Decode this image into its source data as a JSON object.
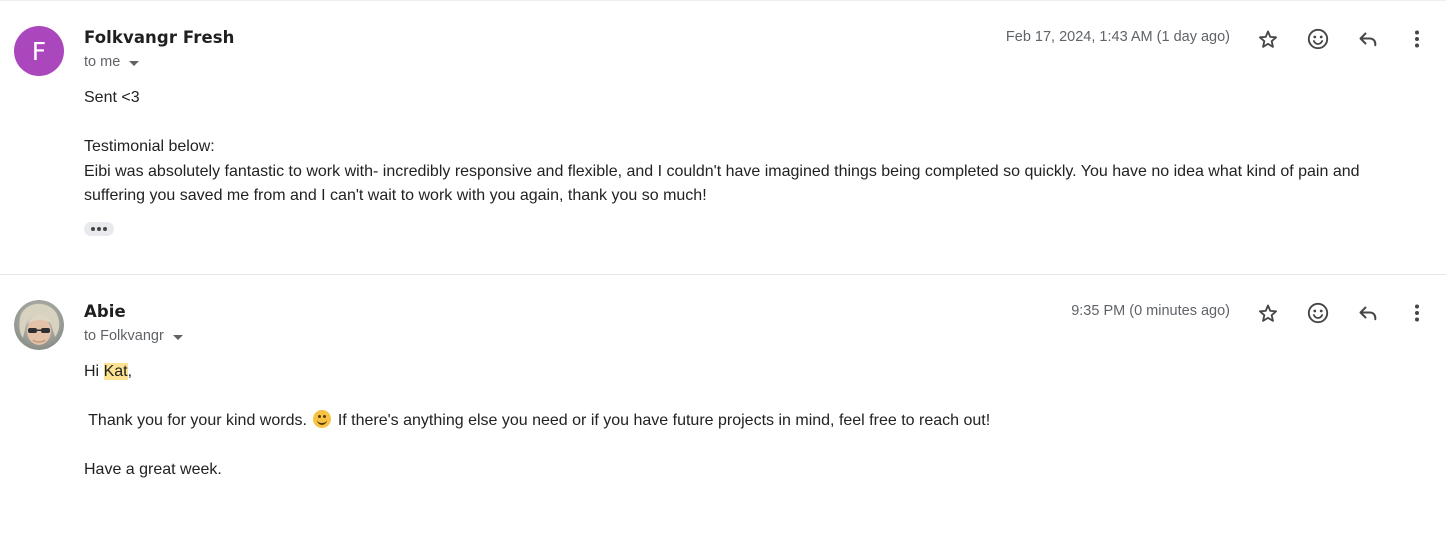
{
  "messages": [
    {
      "avatar_letter": "F",
      "avatar_color": "#ab47bc",
      "sender": "Folkvangr Fresh",
      "recipient": "to me",
      "timestamp": "Feb 17, 2024, 1:43 AM (1 day ago)",
      "body": {
        "line1": "Sent <3",
        "line2": "Testimonial below:",
        "line3": "Eibi was absolutely fantastic to work with- incredibly responsive and flexible, and I couldn't have imagined things being completed so quickly. You have no idea what kind of pain and",
        "line4": "suffering you saved me from and I can't wait to work with you again, thank you so much!"
      },
      "icons": [
        "star-icon",
        "emoji-reaction-icon",
        "reply-icon",
        "more-vert-icon"
      ]
    },
    {
      "avatar_photo": "profile photo",
      "sender": "Abie",
      "recipient": "to Folkvangr",
      "timestamp": "9:35 PM (0 minutes ago)",
      "body": {
        "greeting_prefix": "Hi ",
        "greeting_name": "Kat",
        "greeting_suffix": ",",
        "thanks_start": " Thank you for your kind words.",
        "thanks_emoji": "smiling-face-emoji",
        "thanks_end": " If there's anything else you need or if you have future projects in mind, feel free to reach out!",
        "closing": "Have a great week."
      },
      "icons": [
        "star-icon",
        "emoji-reaction-icon",
        "reply-icon",
        "more-vert-icon"
      ]
    }
  ],
  "colors": {
    "highlight": "#fde293",
    "secondary_text": "#5f6368",
    "icon": "#444746"
  }
}
